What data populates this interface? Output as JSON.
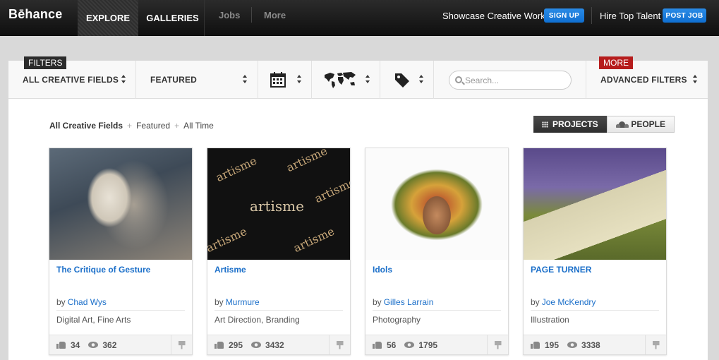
{
  "topbar": {
    "logo": "Bēhance",
    "nav": {
      "explore": "EXPLORE",
      "galleries": "GALLERIES",
      "jobs": "Jobs",
      "more": "More"
    },
    "showcase_text": "Showcase Creative Work",
    "signup_label": "SIGN UP",
    "hire_text": "Hire Top Talent",
    "post_job_label": "POST JOB"
  },
  "filters": {
    "tag_filters": "FILTERS",
    "tag_more": "MORE",
    "creative_fields": "ALL CREATIVE FIELDS",
    "sort": "FEATURED",
    "search_placeholder": "Search...",
    "advanced": "ADVANCED FILTERS",
    "icons": [
      "calendar-icon",
      "world-map-icon",
      "tag-icon"
    ]
  },
  "breadcrumb": {
    "field": "All Creative Fields",
    "sort": "Featured",
    "time": "All Time"
  },
  "view_toggle": {
    "projects": "PROJECTS",
    "people": "PEOPLE",
    "active": "PROJECTS"
  },
  "by_label": "by",
  "projects": [
    {
      "title": "The Critique of Gesture",
      "author": "Chad Wys",
      "fields": "Digital Art, Fine Arts",
      "appreciations": "34",
      "views": "362"
    },
    {
      "title": "Artisme",
      "author": "Murmure",
      "fields": "Art Direction, Branding",
      "appreciations": "295",
      "views": "3432",
      "thumb_text": "artisme"
    },
    {
      "title": "Idols",
      "author": "Gilles Larrain",
      "fields": "Photography",
      "appreciations": "56",
      "views": "1795"
    },
    {
      "title": "PAGE TURNER",
      "author": "Joe McKendry",
      "fields": "Illustration",
      "appreciations": "195",
      "views": "3338"
    }
  ],
  "colors": {
    "link_blue": "#1b6fc9",
    "button_blue": "#1a7bdb",
    "more_red": "#b61c1c"
  }
}
